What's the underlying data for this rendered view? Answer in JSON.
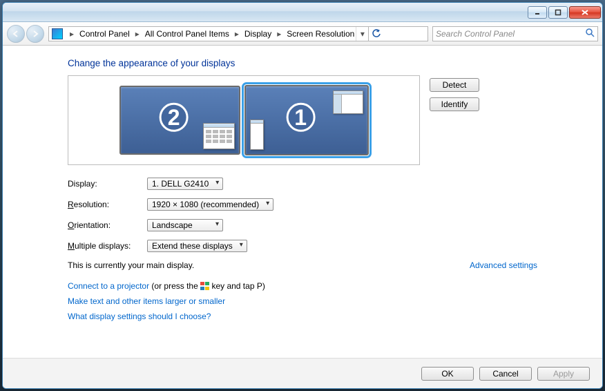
{
  "window_controls": {
    "minimize": "–",
    "maximize": "▢",
    "close": "✕"
  },
  "breadcrumb": {
    "items": [
      "Control Panel",
      "All Control Panel Items",
      "Display",
      "Screen Resolution"
    ]
  },
  "search": {
    "placeholder": "Search Control Panel"
  },
  "heading": "Change the appearance of your displays",
  "monitors": {
    "primary_number": "1",
    "secondary_number": "2"
  },
  "buttons": {
    "detect": "Detect",
    "identify": "Identify",
    "ok": "OK",
    "cancel": "Cancel",
    "apply": "Apply"
  },
  "form": {
    "display_label": "Display:",
    "display_value": "1. DELL G2410",
    "resolution_label_pre": "R",
    "resolution_label_post": "esolution:",
    "resolution_value": "1920 × 1080 (recommended)",
    "orientation_label_pre": "O",
    "orientation_label_post": "rientation:",
    "orientation_value": "Landscape",
    "multi_label_pre": "M",
    "multi_label_post": "ultiple displays:",
    "multi_value": "Extend these displays"
  },
  "status": {
    "main_display": "This is currently your main display.",
    "advanced": "Advanced settings"
  },
  "links": {
    "connect_projector": "Connect to a projector",
    "connect_projector_hint_pre": " (or press the ",
    "connect_projector_hint_post": " key and tap P)",
    "larger_smaller": "Make text and other items larger or smaller",
    "which_settings": "What display settings should I choose?"
  }
}
